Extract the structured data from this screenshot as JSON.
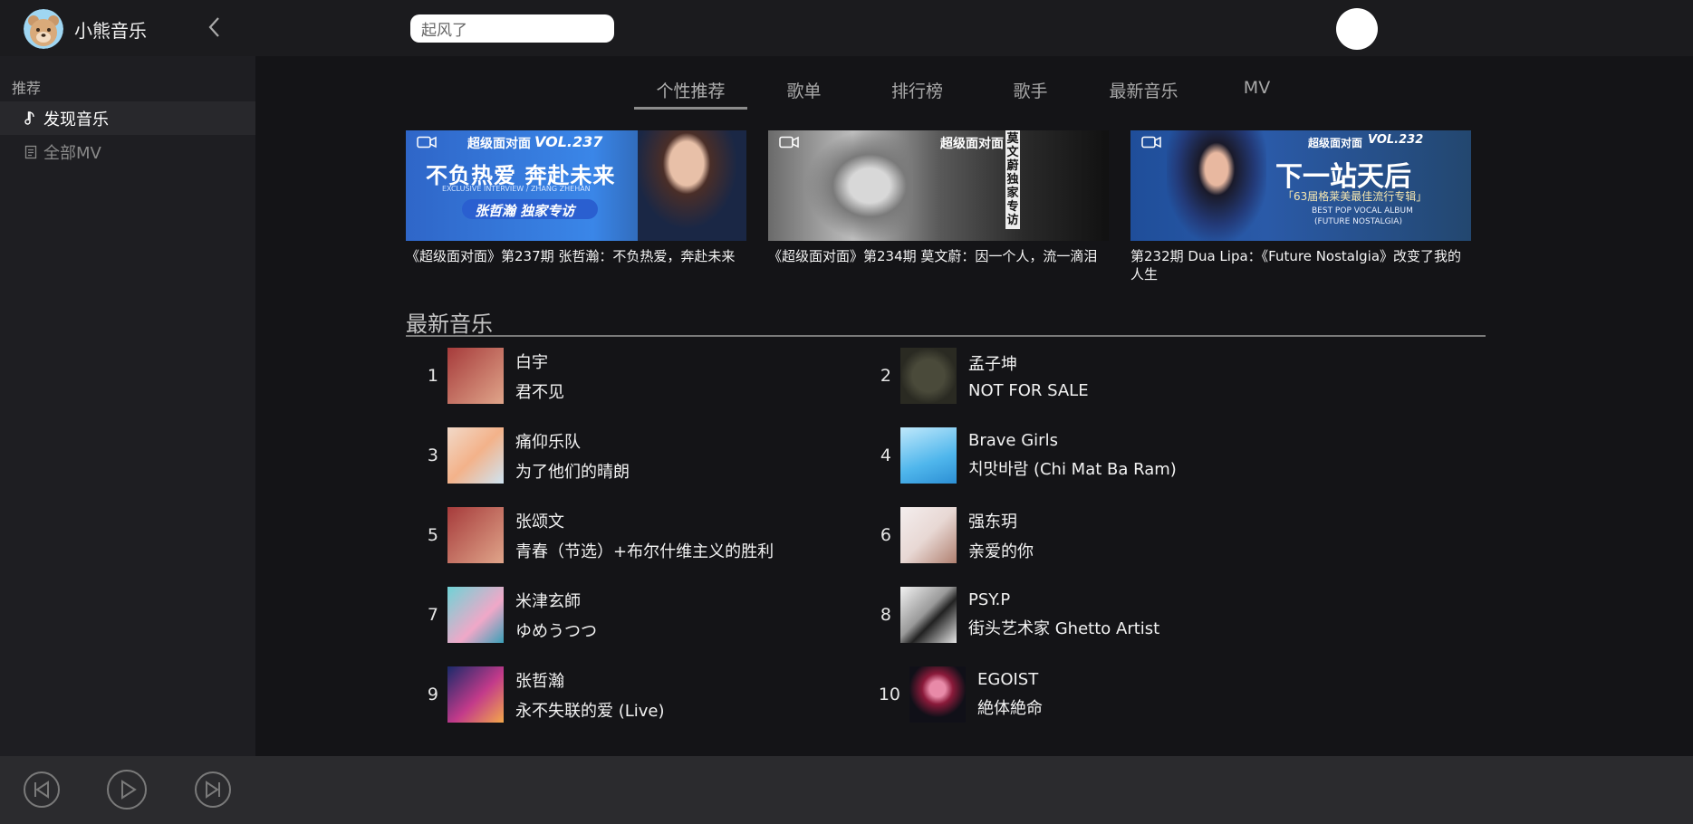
{
  "app": {
    "title": "小熊音乐"
  },
  "search": {
    "value": "起风了"
  },
  "sidebar": {
    "header": "推荐",
    "items": [
      {
        "label": "发现音乐",
        "icon": "music-note-icon",
        "active": true
      },
      {
        "label": "全部MV",
        "icon": "document-icon",
        "active": false
      }
    ]
  },
  "tabs": [
    "个性推荐",
    "歌单",
    "排行榜",
    "歌手",
    "最新音乐",
    "MV"
  ],
  "active_tab": "个性推荐",
  "banners": [
    {
      "caption": "《超级面对面》第237期 张哲瀚：不负热爱，奔赴未来",
      "img_brand": "超级面对面",
      "img_vol": "VOL.237",
      "img_headline": "不负热爱 奔赴未来",
      "img_sub": "EXCLUSIVE INTERVIEW / ZHANG ZHEHAN",
      "img_tag": "张哲瀚 独家专访"
    },
    {
      "caption": "《超级面对面》第234期 莫文蔚：因一个人，流一滴泪",
      "img_brand": "超级面对面",
      "img_tag": "莫文蔚独家专访"
    },
    {
      "caption": "第232期 Dua Lipa：《Future Nostalgia》改变了我的人生",
      "img_brand": "超级面对面",
      "img_vol": "VOL.232",
      "img_headline": "下一站天后",
      "img_sub": "「63届格莱美最佳流行专辑」",
      "img_sub2": "BEST POP VOCAL ALBUM",
      "img_sub3": "(FUTURE NOSTALGIA)"
    }
  ],
  "new_music": {
    "title": "最新音乐",
    "songs": [
      {
        "num": "1",
        "artist": "白宇",
        "title": "君不见"
      },
      {
        "num": "2",
        "artist": "孟子坤",
        "title": "NOT FOR SALE"
      },
      {
        "num": "3",
        "artist": "痛仰乐队",
        "title": "为了他们的晴朗"
      },
      {
        "num": "4",
        "artist": "Brave Girls",
        "title": "치맛바람 (Chi Mat Ba Ram)"
      },
      {
        "num": "5",
        "artist": "张颂文",
        "title": "青春（节选）+布尔什维主义的胜利"
      },
      {
        "num": "6",
        "artist": "强东玥",
        "title": "亲爱的你"
      },
      {
        "num": "7",
        "artist": "米津玄師",
        "title": "ゆめうつつ"
      },
      {
        "num": "8",
        "artist": "PSY.P",
        "title": "街头艺术家 Ghetto Artist"
      },
      {
        "num": "9",
        "artist": "张哲瀚",
        "title": "永不失联的爱 (Live)"
      },
      {
        "num": "10",
        "artist": "EGOIST",
        "title": "絶体絶命"
      }
    ]
  },
  "player": {
    "buttons": [
      "previous-icon",
      "play-icon",
      "next-icon"
    ]
  }
}
